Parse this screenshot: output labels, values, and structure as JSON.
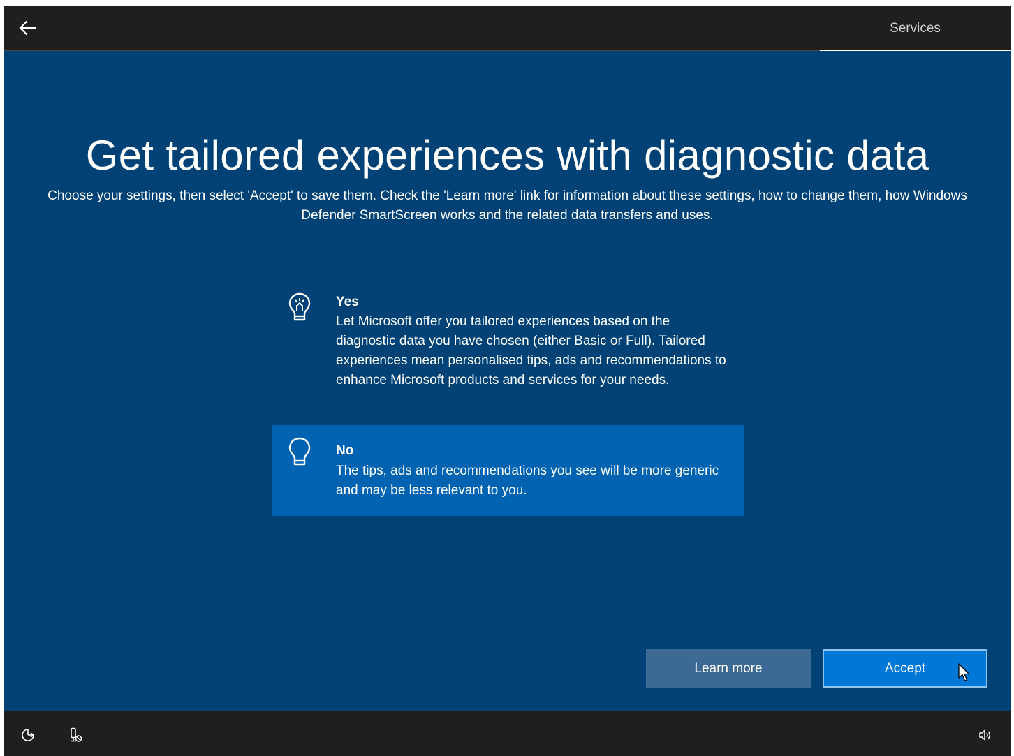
{
  "header": {
    "back_icon": "back-arrow-icon",
    "tab_label": "Services"
  },
  "main": {
    "title": "Get tailored experiences with diagnostic data",
    "subtitle": "Choose your settings, then select 'Accept' to save them. Check the 'Learn more' link for information about these settings, how to change them, how Windows Defender SmartScreen works and the related data transfers and uses.",
    "options": [
      {
        "icon": "lightbulb-on-icon",
        "title": "Yes",
        "description": "Let Microsoft offer you tailored experiences based on the diagnostic data you have chosen (either Basic or Full). Tailored experiences mean personalised tips, ads and recommendations to enhance Microsoft products and services for your needs.",
        "selected": false
      },
      {
        "icon": "lightbulb-off-icon",
        "title": "No",
        "description": "The tips, ads and recommendations you see will be more generic and may be less relevant to you.",
        "selected": true
      }
    ]
  },
  "buttons": {
    "learn_more": "Learn more",
    "accept": "Accept"
  },
  "footer": {
    "icons": [
      "ease-of-access-icon",
      "microphone-muted-icon",
      "volume-icon"
    ]
  },
  "colors": {
    "background": "#004275",
    "bar": "#1f1f1f",
    "selected_option": "#0063b1",
    "accept_button": "#0078d7",
    "learn_more_button": "#3c6a95"
  }
}
